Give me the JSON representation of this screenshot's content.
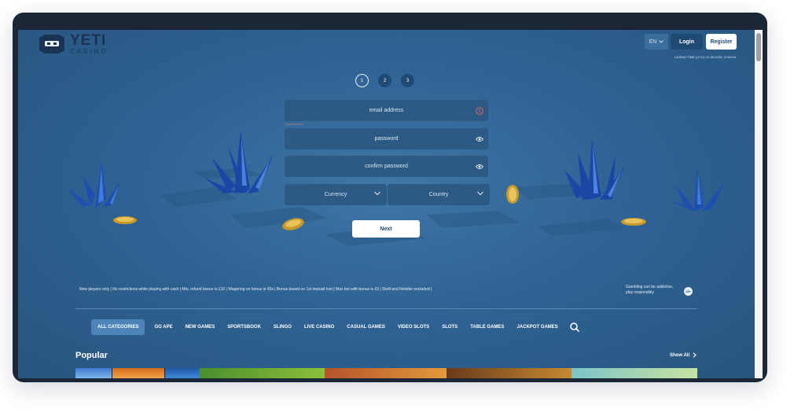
{
  "header": {
    "brand": "YETI",
    "brand_sub": "CASINO",
    "language": "EN",
    "login_label": "Login",
    "register_label": "Register",
    "casino_time": "CASINO TIME (UTC): 22.05.2025, 22:59:59"
  },
  "steps": [
    "1",
    "2",
    "3"
  ],
  "form": {
    "email_placeholder": "email address",
    "email_error": "required field",
    "password_placeholder": "password",
    "confirm_placeholder": "confirm password",
    "currency_label": "Currency",
    "country_label": "Country",
    "next_label": "Next"
  },
  "terms": "New players only | No restrictions while playing with cash | Min. refund bonus is £10 | Wagering on bonus is 60x | Bonus based on 1st deposit lost | Max bet with bonus is £5 | Skrill and Neteller excluded |",
  "gambling_notice": [
    "Gambling can be addictive,",
    "play responsibly"
  ],
  "gambling_badge": "18+",
  "categories": [
    "ALL CATEGORIES",
    "GO APE",
    "NEW GAMES",
    "SPORTSBOOK",
    "SLINGO",
    "LIVE CASINO",
    "CASUAL GAMES",
    "VIDEO SLOTS",
    "SLOTS",
    "TABLE GAMES",
    "JACKPOT GAMES"
  ],
  "popular": {
    "title": "Popular",
    "show_all": "Show All"
  },
  "colors": {
    "background": "#2f6394",
    "field": "#2c5a84",
    "brand_dark": "#1f4a73",
    "active_tab": "#4d85b8",
    "error": "#c97777"
  },
  "icons": [
    "yeti-logo-icon",
    "chevron-down-icon",
    "error-circle-icon",
    "eye-icon",
    "search-icon",
    "chevron-right-icon",
    "age-badge-icon"
  ]
}
